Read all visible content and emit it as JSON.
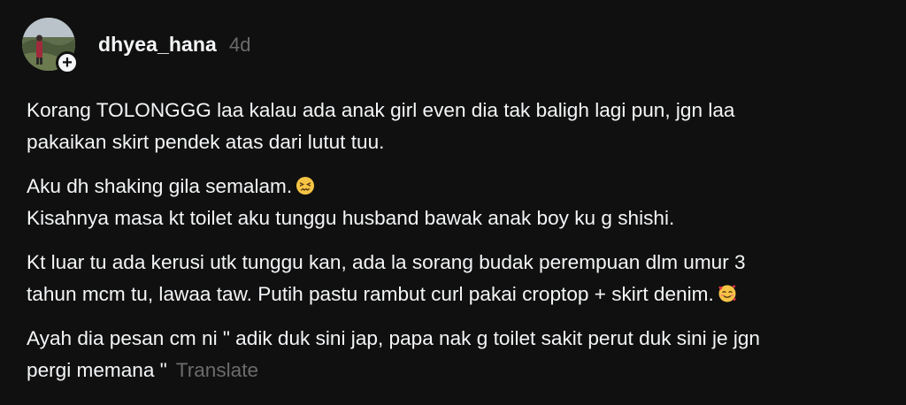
{
  "post": {
    "author": {
      "username": "dhyea_hana",
      "time_ago": "4d",
      "follow_badge": "+"
    },
    "paragraphs": [
      {
        "lines": [
          "Korang TOLONGGG laa kalau ada anak girl even dia tak baligh lagi pun, jgn laa",
          "pakaikan skirt pendek atas dari lutut tuu."
        ]
      },
      {
        "lines": [
          "Aku dh shaking gila semalam.",
          "Kisahnya masa kt toilet aku tunggu husband bawak anak boy ku g shishi."
        ],
        "emoji_line1": "confounded-face"
      },
      {
        "lines": [
          "Kt luar tu ada kerusi utk tunggu kan, ada la sorang budak perempuan dlm umur 3",
          "tahun mcm tu, lawaa taw. Putih pastu rambut curl pakai croptop + skirt denim."
        ],
        "emoji_line2": "smiling-face-with-hearts"
      },
      {
        "lines": [
          "Ayah dia pesan cm ni \" adik duk sini jap, papa nak g toilet sakit perut duk sini je jgn",
          "pergi memana \""
        ]
      }
    ],
    "translate_label": "Translate"
  },
  "colors": {
    "background": "#101010",
    "primary_text": "#f3f5f7",
    "secondary_text": "#6b6b6b"
  }
}
